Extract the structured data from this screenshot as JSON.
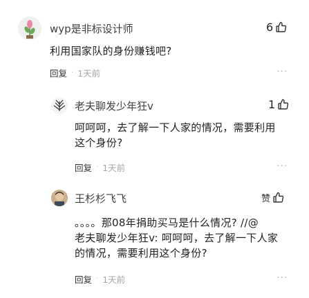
{
  "comments": [
    {
      "username": "wyp是非标设计师",
      "likes": "6",
      "text": "利用国家队的身份赚钱吧?",
      "reply_label": "回复",
      "separator": "·",
      "time": "1天前"
    },
    {
      "username": "老夫聊发少年狂v",
      "likes": "1",
      "text_line1": "呵呵呵，去了解一下人家的情况，需要利用",
      "text_line2": "这个身份?",
      "reply_label": "回复",
      "separator": "·",
      "time": "1天前"
    },
    {
      "username": "王杉杉飞飞",
      "likes": "赞",
      "text_line1": "。。。。那08年捐助买马是什么情况? //@",
      "text_line2": "老夫聊发少年狂v: 呵呵呵，去了解一下人家",
      "text_line3": "的情况，需要利用这个身份?",
      "reply_label": "回复",
      "separator": "·",
      "time": "1天前"
    }
  ],
  "colors": {
    "text": "#222222",
    "username": "#404040",
    "time": "#a6a6a6"
  },
  "icons": {
    "like": "thumbs-up-icon",
    "more": "ellipsis-icon"
  }
}
